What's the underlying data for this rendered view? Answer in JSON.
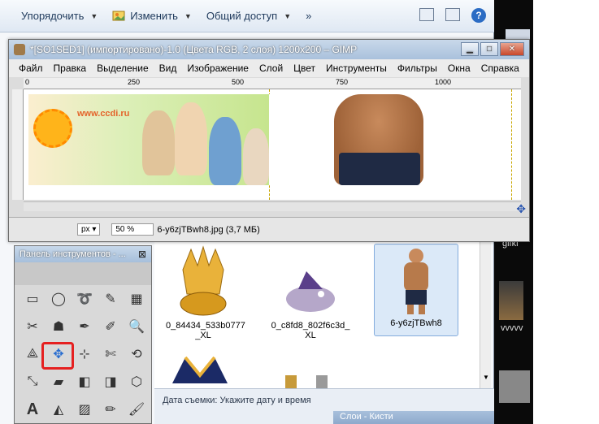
{
  "explorer": {
    "toolbar": {
      "organize": "Упорядочить",
      "change": "Изменить",
      "share": "Общий доступ",
      "more": "»"
    },
    "files": [
      {
        "name": "0_84434_533b0777\n_XL",
        "line1": "0_84434_533b0777",
        "line2": "_XL"
      },
      {
        "name": "0_c8fd8_802f6c3d_XL",
        "line1": "0_c8fd8_802f6c3d_",
        "line2": "XL"
      },
      {
        "name": "6-y6zjTBwh8",
        "line1": "6-y6zjTBwh8",
        "line2": ""
      }
    ],
    "details": "Дата съемки: Укажите дату и время"
  },
  "gimp": {
    "title": "*[SO1SED1] (импортировано)-1.0 (Цвета RGB, 2 слоя) 1200x200 – GIMP",
    "menu": [
      "Файл",
      "Правка",
      "Выделение",
      "Вид",
      "Изображение",
      "Слой",
      "Цвет",
      "Инструменты",
      "Фильтры",
      "Окна",
      "Справка"
    ],
    "ruler": [
      "0",
      "250",
      "500",
      "750",
      "1000"
    ],
    "banner_site": "www.ccdi.ru",
    "status": {
      "unit": "px",
      "zoom": "50 %",
      "file": "6-y6zjTBwh8.jpg (3,7 МБ)"
    }
  },
  "toolbox": {
    "title": "Панель инструментов - ...",
    "close": "⊠"
  },
  "layers": {
    "title": "Слои - Кисти"
  },
  "desktop": {
    "labels": [
      "gifki",
      "vvvvv"
    ]
  }
}
